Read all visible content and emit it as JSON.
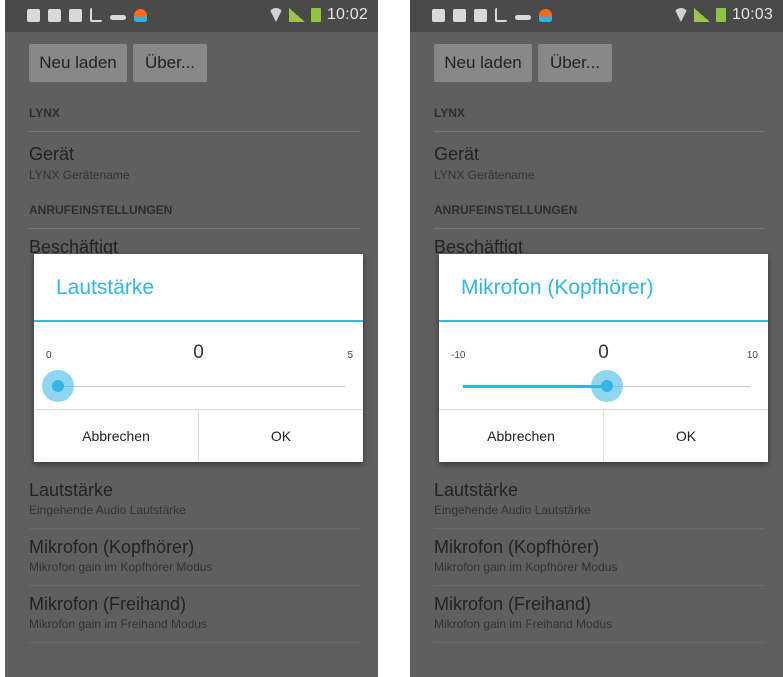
{
  "screens": [
    {
      "status": {
        "time": "10:02"
      },
      "actionbar": {
        "reload": "Neu laden",
        "about": "Über..."
      },
      "sections": {
        "lynx": "LYNX",
        "calls": "ANRUFEINSTELLUNGEN"
      },
      "prefs_top": [
        {
          "title": "Gerät",
          "summary": "LYNX Gerätename"
        },
        {
          "title": "Beschäftigt",
          "summary": ""
        }
      ],
      "prefs_bottom": [
        {
          "title": "Lautstärke",
          "summary": "Eingehende Audio Lautstärke"
        },
        {
          "title": "Mikrofon (Kopfhörer)",
          "summary": "Mikrofon gain im Kopfhörer Modus"
        },
        {
          "title": "Mikrofon (Freihand)",
          "summary": "Mikrofon gain im Freihand Modus"
        }
      ],
      "dialog": {
        "title": "Lautstärke",
        "min": "0",
        "max": "5",
        "value": "0",
        "slider_fraction": 0.0,
        "cancel": "Abbrechen",
        "ok": "OK"
      }
    },
    {
      "status": {
        "time": "10:03"
      },
      "actionbar": {
        "reload": "Neu laden",
        "about": "Über..."
      },
      "sections": {
        "lynx": "LYNX",
        "calls": "ANRUFEINSTELLUNGEN"
      },
      "prefs_top": [
        {
          "title": "Gerät",
          "summary": "LYNX Gerätename"
        },
        {
          "title": "Beschäftigt",
          "summary": ""
        }
      ],
      "prefs_bottom": [
        {
          "title": "Lautstärke",
          "summary": "Eingehende Audio Lautstärke"
        },
        {
          "title": "Mikrofon (Kopfhörer)",
          "summary": "Mikrofon gain im Kopfhörer Modus"
        },
        {
          "title": "Mikrofon (Freihand)",
          "summary": "Mikrofon gain im Freihand Modus"
        }
      ],
      "dialog": {
        "title": "Mikrofon (Kopfhörer)",
        "min": "-10",
        "max": "10",
        "value": "0",
        "slider_fraction": 0.5,
        "cancel": "Abbrechen",
        "ok": "OK"
      }
    }
  ],
  "colors": {
    "accent": "#33b5e5",
    "dim_background": "#5f5f5f"
  },
  "icons": [
    "screenshot-icon",
    "gallery-icon",
    "upload-icon",
    "download-icon",
    "key-icon",
    "app-icon",
    "wifi-icon",
    "signal-icon",
    "battery-icon"
  ]
}
